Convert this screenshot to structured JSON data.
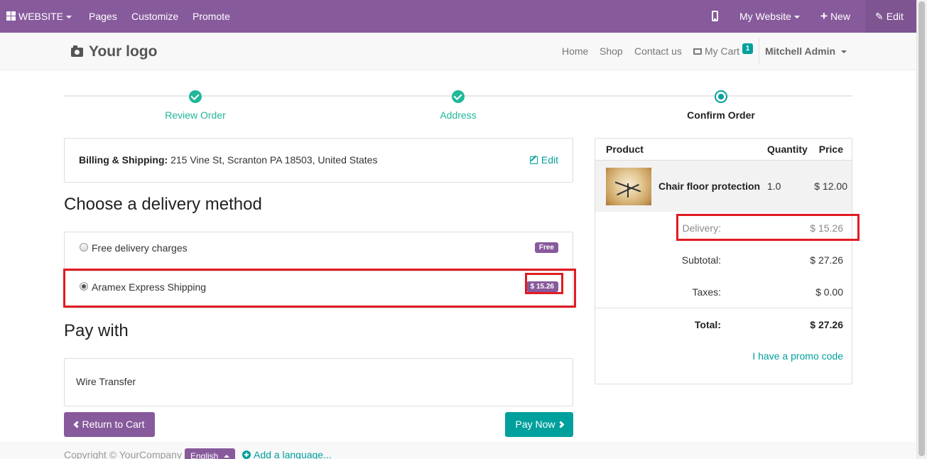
{
  "admin_bar": {
    "website_menu": "WEBSITE",
    "pages": "Pages",
    "customize": "Customize",
    "promote": "Promote",
    "my_website": "My Website",
    "new": "New",
    "edit": "Edit",
    "bar_color": "#875a9c"
  },
  "header": {
    "logo_text": "Your logo",
    "nav": {
      "home": "Home",
      "shop": "Shop",
      "contact": "Contact us",
      "cart": "My Cart",
      "cart_count": "1",
      "user": "Mitchell Admin"
    }
  },
  "wizard": {
    "steps": [
      {
        "label": "Review Order",
        "state": "done"
      },
      {
        "label": "Address",
        "state": "done"
      },
      {
        "label": "Confirm Order",
        "state": "current"
      }
    ]
  },
  "billing": {
    "label": "Billing & Shipping:",
    "address": "215 Vine St, Scranton PA 18503, United States",
    "edit": "Edit"
  },
  "delivery": {
    "title": "Choose a delivery method",
    "methods": [
      {
        "name": "Free delivery charges",
        "badge": "Free",
        "selected": false
      },
      {
        "name": "Aramex Express Shipping",
        "badge": "$ 15.26",
        "selected": true
      }
    ]
  },
  "payment": {
    "title": "Pay with",
    "method": "Wire Transfer"
  },
  "buttons": {
    "return_to_cart": "Return to Cart",
    "pay_now": "Pay Now"
  },
  "summary": {
    "headers": {
      "product": "Product",
      "quantity": "Quantity",
      "price": "Price"
    },
    "product": {
      "name": "Chair floor protection",
      "quantity": "1.0",
      "price": "$ 12.00"
    },
    "delivery_label": "Delivery:",
    "delivery_value": "$ 15.26",
    "subtotal_label": "Subtotal:",
    "subtotal_value": "$ 27.26",
    "taxes_label": "Taxes:",
    "taxes_value": "$ 0.00",
    "total_label": "Total:",
    "total_value": "$ 27.26",
    "promo": "I have a promo code"
  },
  "footer": {
    "copyright": "Copyright © YourCompany",
    "language": "English",
    "add_language": "Add a language..."
  },
  "colors": {
    "accent": "#00a09d",
    "brand": "#875a9c",
    "step_done": "#21b799",
    "highlight": "#e11b22"
  }
}
